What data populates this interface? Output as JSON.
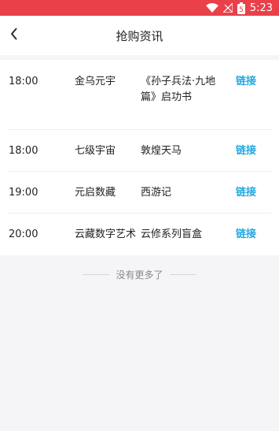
{
  "status_bar": {
    "time": "5:23",
    "battery_level": "5",
    "icons": [
      "wifi-icon",
      "signal-off-icon",
      "battery-icon"
    ]
  },
  "header": {
    "title": "抢购资讯",
    "back_icon": "chevron-left-icon"
  },
  "list": {
    "rows": [
      {
        "time": "18:00",
        "platform": "金乌元宇",
        "product": "《孙子兵法·九地篇》启功书",
        "link": "链接"
      },
      {
        "time": "18:00",
        "platform": "七级宇宙",
        "product": "敦煌天马",
        "link": "链接"
      },
      {
        "time": "19:00",
        "platform": "元启数藏",
        "product": "西游记",
        "link": "链接"
      },
      {
        "time": "20:00",
        "platform": "云藏数字艺术",
        "product": "云修系列盲盒",
        "link": "链接"
      }
    ]
  },
  "footer": {
    "no_more_text": "没有更多了"
  },
  "colors": {
    "status_bar": "#e9404a",
    "link": "#23a8e0",
    "background": "#f5f5f7"
  }
}
